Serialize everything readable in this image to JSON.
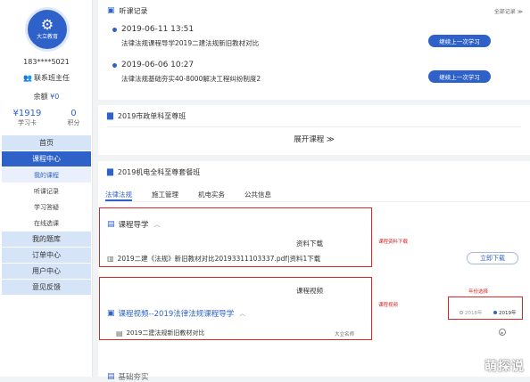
{
  "sidebar": {
    "logo_text": "大立教育",
    "phone": "183****5021",
    "contact_label": "联系班主任",
    "balance_label": "余额",
    "balance_value": "¥0",
    "stats": [
      {
        "value": "¥1919",
        "label": "学习卡"
      },
      {
        "value": "0",
        "label": "积分"
      }
    ],
    "menu": [
      {
        "label": "首页"
      },
      {
        "label": "课程中心"
      },
      {
        "label": "我的课程"
      },
      {
        "label": "听课记录"
      },
      {
        "label": "学习答疑"
      },
      {
        "label": "在线选课"
      },
      {
        "label": "我的题库"
      },
      {
        "label": "订单中心"
      },
      {
        "label": "用户中心"
      },
      {
        "label": "意见反馈"
      }
    ]
  },
  "records": {
    "title": "听课记录",
    "all_link": "全部记录 ≫",
    "items": [
      {
        "time": "2019-06-11 13:51",
        "title": "法律法规课程导学2019二建法规新旧教材对比",
        "button": "继续上一次学习"
      },
      {
        "time": "2019-06-06 10:27",
        "title": "法律法规基础夯实40-8000解决工程纠纷制度2",
        "button": "继续上一次学习"
      }
    ]
  },
  "course1": {
    "title": "2019市政单科至尊班",
    "expand_label": "展开课程 ≫"
  },
  "course2": {
    "title": "2019机电全科至尊套餐班",
    "tabs": [
      "法律法规",
      "施工管理",
      "机电实务",
      "公共信息"
    ],
    "guide": {
      "title": "课程导学",
      "overlay_label": "资料下载",
      "file_name": "2019二建《法规》新旧教材对比20193311103337.pdf|资料1下载",
      "download_button": "立即下载"
    },
    "video": {
      "title": "课程视频--2019法律法规课程导学",
      "overlay_label": "课程视频",
      "item_name": "2019二建法规新旧教材对比",
      "item_teacher": "大立名师"
    },
    "annotations": {
      "download": "课程资料下载",
      "video": "课程视频",
      "year": "年份选择"
    },
    "years": [
      "2018年",
      "2019年"
    ],
    "next_section_partial": "基础夯实"
  },
  "watermark": "萌探说"
}
